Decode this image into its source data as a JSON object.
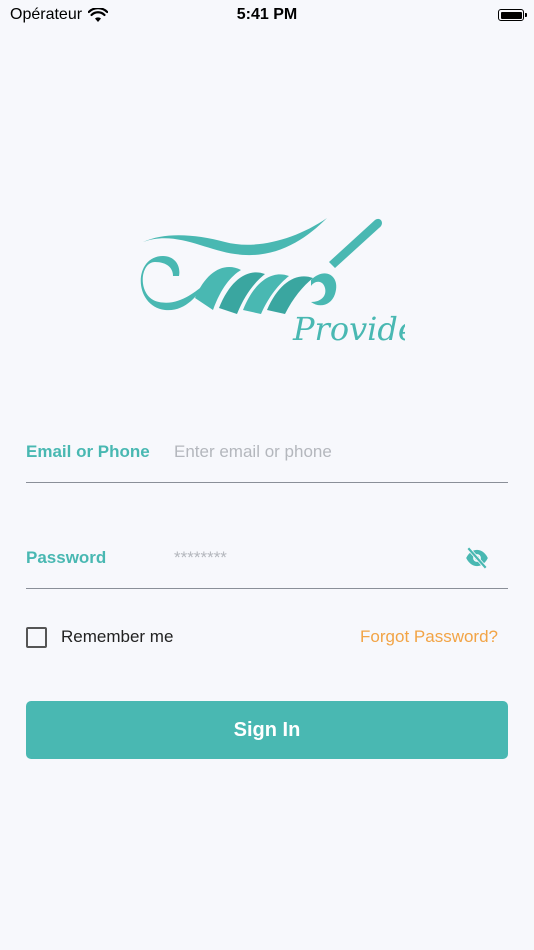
{
  "status_bar": {
    "carrier": "Opérateur",
    "time": "5:41 PM"
  },
  "logo": {
    "wordmark": "Provider"
  },
  "form": {
    "email": {
      "label": "Email or Phone",
      "placeholder": "Enter email or phone",
      "value": ""
    },
    "password": {
      "label": "Password",
      "placeholder": "********",
      "value": ""
    },
    "remember_label": "Remember me",
    "forgot_label": "Forgot Password?",
    "signin_label": "Sign In"
  },
  "colors": {
    "brand_teal": "#49b8b2",
    "accent_orange": "#f2a446",
    "background": "#f7f8fc"
  },
  "icons": [
    "wifi-icon",
    "battery-icon",
    "eye-off-icon",
    "checkbox-icon"
  ]
}
